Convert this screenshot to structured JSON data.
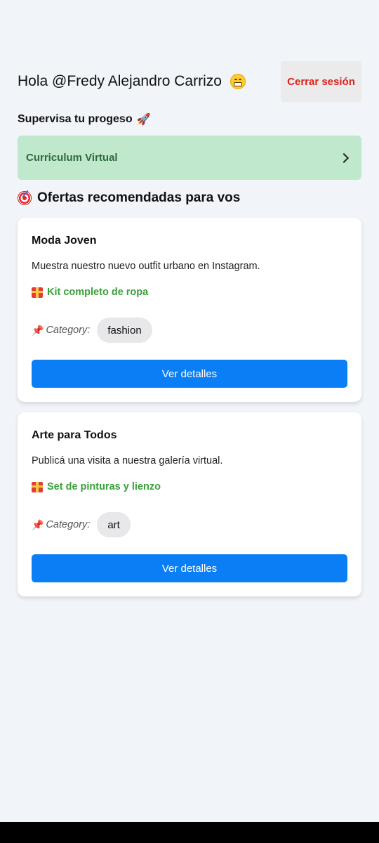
{
  "header": {
    "greeting": "Hola @Fredy Alejandro Carrizo",
    "greeting_emoji": "grinning-face-icon",
    "logout_label": "Cerrar sesión"
  },
  "progress": {
    "subtitle": "Supervisa tu progeso",
    "subtitle_emoji": "rocket-icon",
    "cv_label": "Curriculum Virtual"
  },
  "offers": {
    "section_title": "Ofertas recomendadas para vos",
    "items": [
      {
        "title": "Moda Joven",
        "description": "Muestra nuestro nuevo outfit urbano en Instagram.",
        "reward": "Kit completo de ropa",
        "category_label": "Category:",
        "category": "fashion",
        "button_label": "Ver detalles"
      },
      {
        "title": "Arte para Todos",
        "description": "Publicá una visita a nuestra galería virtual.",
        "reward": "Set de pinturas y lienzo",
        "category_label": "Category:",
        "category": "art",
        "button_label": "Ver detalles"
      }
    ]
  },
  "colors": {
    "background": "#f1f4f9",
    "accent_blue": "#0a7ff5",
    "cv_green": "#bfe8cc",
    "reward_green": "#3aa03a",
    "logout_red": "#e0201c"
  }
}
